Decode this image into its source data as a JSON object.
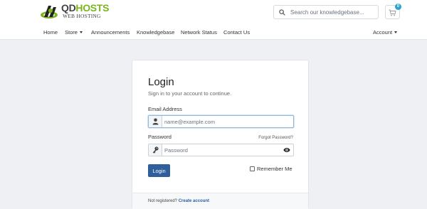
{
  "brand": {
    "logo_main_prefix": "QD",
    "logo_main_accent": "HOSTS",
    "logo_sub": "WEB HOSTING",
    "accent_color": "#7ab51d"
  },
  "search": {
    "placeholder": "Search our knowledgebase...",
    "icon": "search-icon"
  },
  "cart": {
    "badge_count": "0",
    "icon": "cart-icon",
    "badge_color": "#2aa4c8"
  },
  "nav": {
    "home": "Home",
    "store": "Store",
    "announcements": "Announcements",
    "knowledgebase": "Knowledgebase",
    "network_status": "Network Status",
    "contact_us": "Contact Us",
    "account": "Account"
  },
  "login": {
    "title": "Login",
    "subtitle": "Sign in to your account to continue.",
    "email_label": "Email Address",
    "email_placeholder": "name@example.com",
    "password_label": "Password",
    "forgot_password": "Forgot Password?",
    "password_placeholder": "Password",
    "submit_label": "Login",
    "remember_me": "Remember Me",
    "button_color": "#2f5f9b"
  },
  "footer": {
    "not_registered": "Not registered?",
    "create_account": "Create account"
  }
}
